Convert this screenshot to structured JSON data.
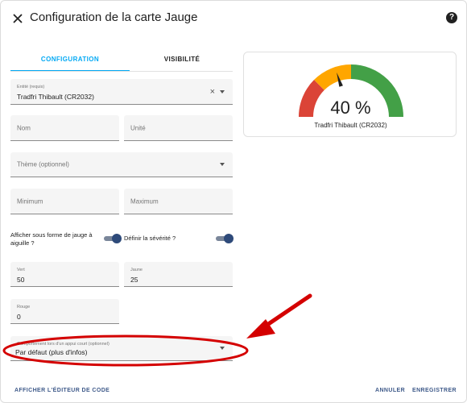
{
  "header": {
    "title": "Configuration de la carte Jauge",
    "help_label": "?"
  },
  "tabs": [
    {
      "label": "CONFIGURATION",
      "active": true
    },
    {
      "label": "VISIBILITÉ",
      "active": false
    }
  ],
  "form": {
    "entity": {
      "label": "Entité (requis)",
      "value": "Tradfri Thibault (CR2032)"
    },
    "name": {
      "placeholder": "Nom"
    },
    "unit": {
      "placeholder": "Unité"
    },
    "theme": {
      "placeholder": "Thème (optionnel)"
    },
    "minimum": {
      "placeholder": "Minimum"
    },
    "maximum": {
      "placeholder": "Maximum"
    },
    "needle_toggle": {
      "label": "Afficher sous forme de jauge à aiguille ?",
      "on": true
    },
    "severity_toggle": {
      "label": "Définir la sévérité ?",
      "on": true
    },
    "green": {
      "label": "Vert",
      "value": "50"
    },
    "yellow": {
      "label": "Jaune",
      "value": "25"
    },
    "red": {
      "label": "Rouge",
      "value": "0"
    },
    "tap_action": {
      "label": "Comportement lors d'un appui court (optionnel)",
      "value": "Par défaut (plus d'infos)"
    }
  },
  "preview": {
    "value_text": "40 %",
    "entity_name": "Tradfri Thibault (CR2032)",
    "level": 0.4,
    "colors": {
      "red": "#db4437",
      "yellow": "#ffa600",
      "green": "#43a047",
      "needle": "#212121"
    }
  },
  "footer": {
    "code_editor": "AFFICHER L'ÉDITEUR DE CODE",
    "cancel": "ANNULER",
    "save": "ENREGISTRER"
  },
  "annotation": {
    "color": "#d40000"
  }
}
